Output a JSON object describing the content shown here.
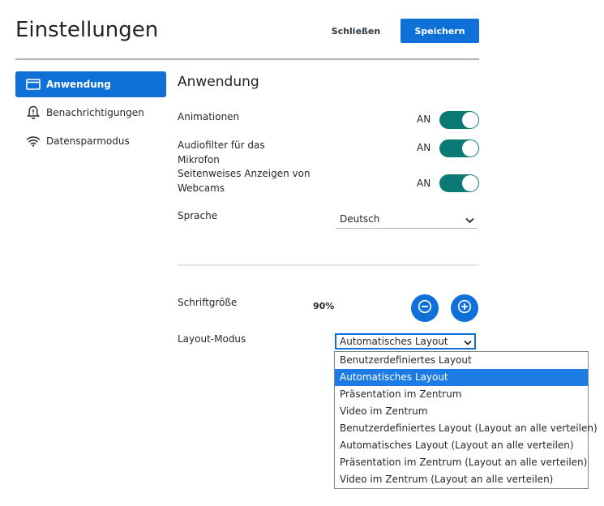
{
  "header": {
    "title": "Einstellungen",
    "close_label": "Schließen",
    "save_label": "Speichern"
  },
  "sidebar": {
    "items": [
      {
        "label": "Anwendung",
        "icon": "application-window-icon",
        "active": true
      },
      {
        "label": "Benachrichtigungen",
        "icon": "bell-alert-icon",
        "active": false
      },
      {
        "label": "Datensparmodus",
        "icon": "wifi-icon",
        "active": false
      }
    ]
  },
  "main": {
    "section_title": "Anwendung",
    "toggles": [
      {
        "label": "Animationen",
        "state_text": "AN",
        "on": true
      },
      {
        "label": "Audiofilter für das Mikrofon",
        "state_text": "AN",
        "on": true
      },
      {
        "label": "Seitenweises Anzeigen von Webcams",
        "state_text": "AN",
        "on": true
      }
    ],
    "language": {
      "label": "Sprache",
      "value": "Deutsch"
    },
    "font_size": {
      "label": "Schriftgröße",
      "value": "90%"
    },
    "layout_mode": {
      "label": "Layout-Modus",
      "value": "Automatisches Layout",
      "options": [
        "Benutzerdefiniertes Layout",
        "Automatisches Layout",
        "Präsentation im Zentrum",
        "Video im Zentrum",
        "Benutzerdefiniertes Layout (Layout an alle verteilen)",
        "Automatisches Layout (Layout an alle verteilen)",
        "Präsentation im Zentrum (Layout an alle verteilen)",
        "Video im Zentrum (Layout an alle verteilen)"
      ],
      "selected_index": 1
    }
  },
  "colors": {
    "accent": "#0f70d7",
    "toggle_on": "#0b7a75",
    "option_highlight": "#1d7be5"
  }
}
